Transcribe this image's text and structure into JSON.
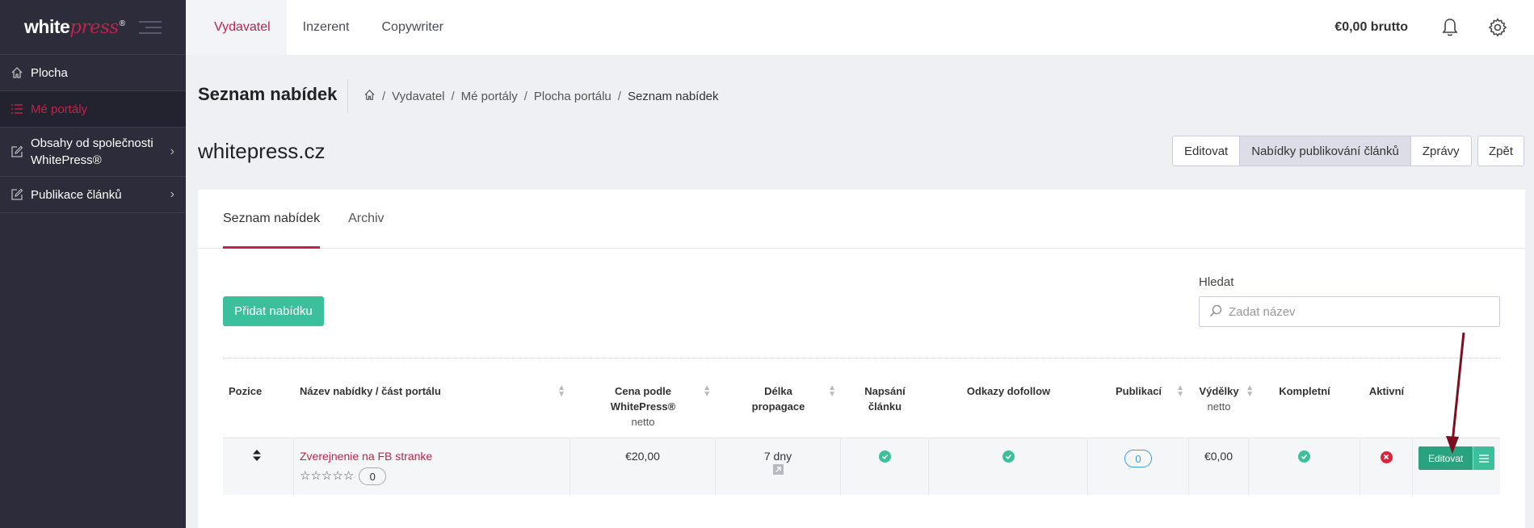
{
  "brand": {
    "name_white": "white",
    "name_press": "press",
    "reg": "®"
  },
  "sidebar": {
    "items": [
      {
        "label": "Plocha",
        "icon": "home-icon"
      },
      {
        "label": "Mé portály",
        "icon": "list-icon"
      },
      {
        "label": "Obsahy od společnosti WhitePress®",
        "icon": "edit-icon"
      },
      {
        "label": "Publikace článků",
        "icon": "edit-icon"
      }
    ]
  },
  "topbar": {
    "tabs": [
      "Vydavatel",
      "Inzerent",
      "Copywriter"
    ],
    "balance": "€0,00 brutto"
  },
  "header": {
    "title": "Seznam nabídek",
    "breadcrumb": [
      "Vydavatel",
      "Mé portály",
      "Plocha portálu",
      "Seznam nabídek"
    ],
    "sep": "/"
  },
  "site": {
    "title": "whitepress.cz",
    "actions": [
      "Editovat",
      "Nabídky publikování článků",
      "Zprávy"
    ],
    "back": "Zpět"
  },
  "card": {
    "tabs": [
      "Seznam nabídek",
      "Archiv"
    ],
    "add_button": "Přidat nabídku",
    "search_label": "Hledat",
    "search_placeholder": "Zadat název"
  },
  "table": {
    "headers": {
      "position": "Pozice",
      "name": "Název nabídky / část portálu",
      "price": "Cena podle WhitePress®",
      "price_sub": "netto",
      "length": "Délka propagace",
      "writing": "Napsání článku",
      "dofollow": "Odkazy dofollow",
      "publications": "Publikací",
      "earnings": "Výdělky",
      "earnings_sub": "netto",
      "complete": "Kompletní",
      "active": "Aktivní"
    },
    "rows": [
      {
        "name": "Zverejnenie na FB stranke",
        "rating": "0",
        "price": "€20,00",
        "length": "7 dny",
        "publications": "0",
        "earnings": "€0,00",
        "edit": "Editovat"
      }
    ]
  }
}
